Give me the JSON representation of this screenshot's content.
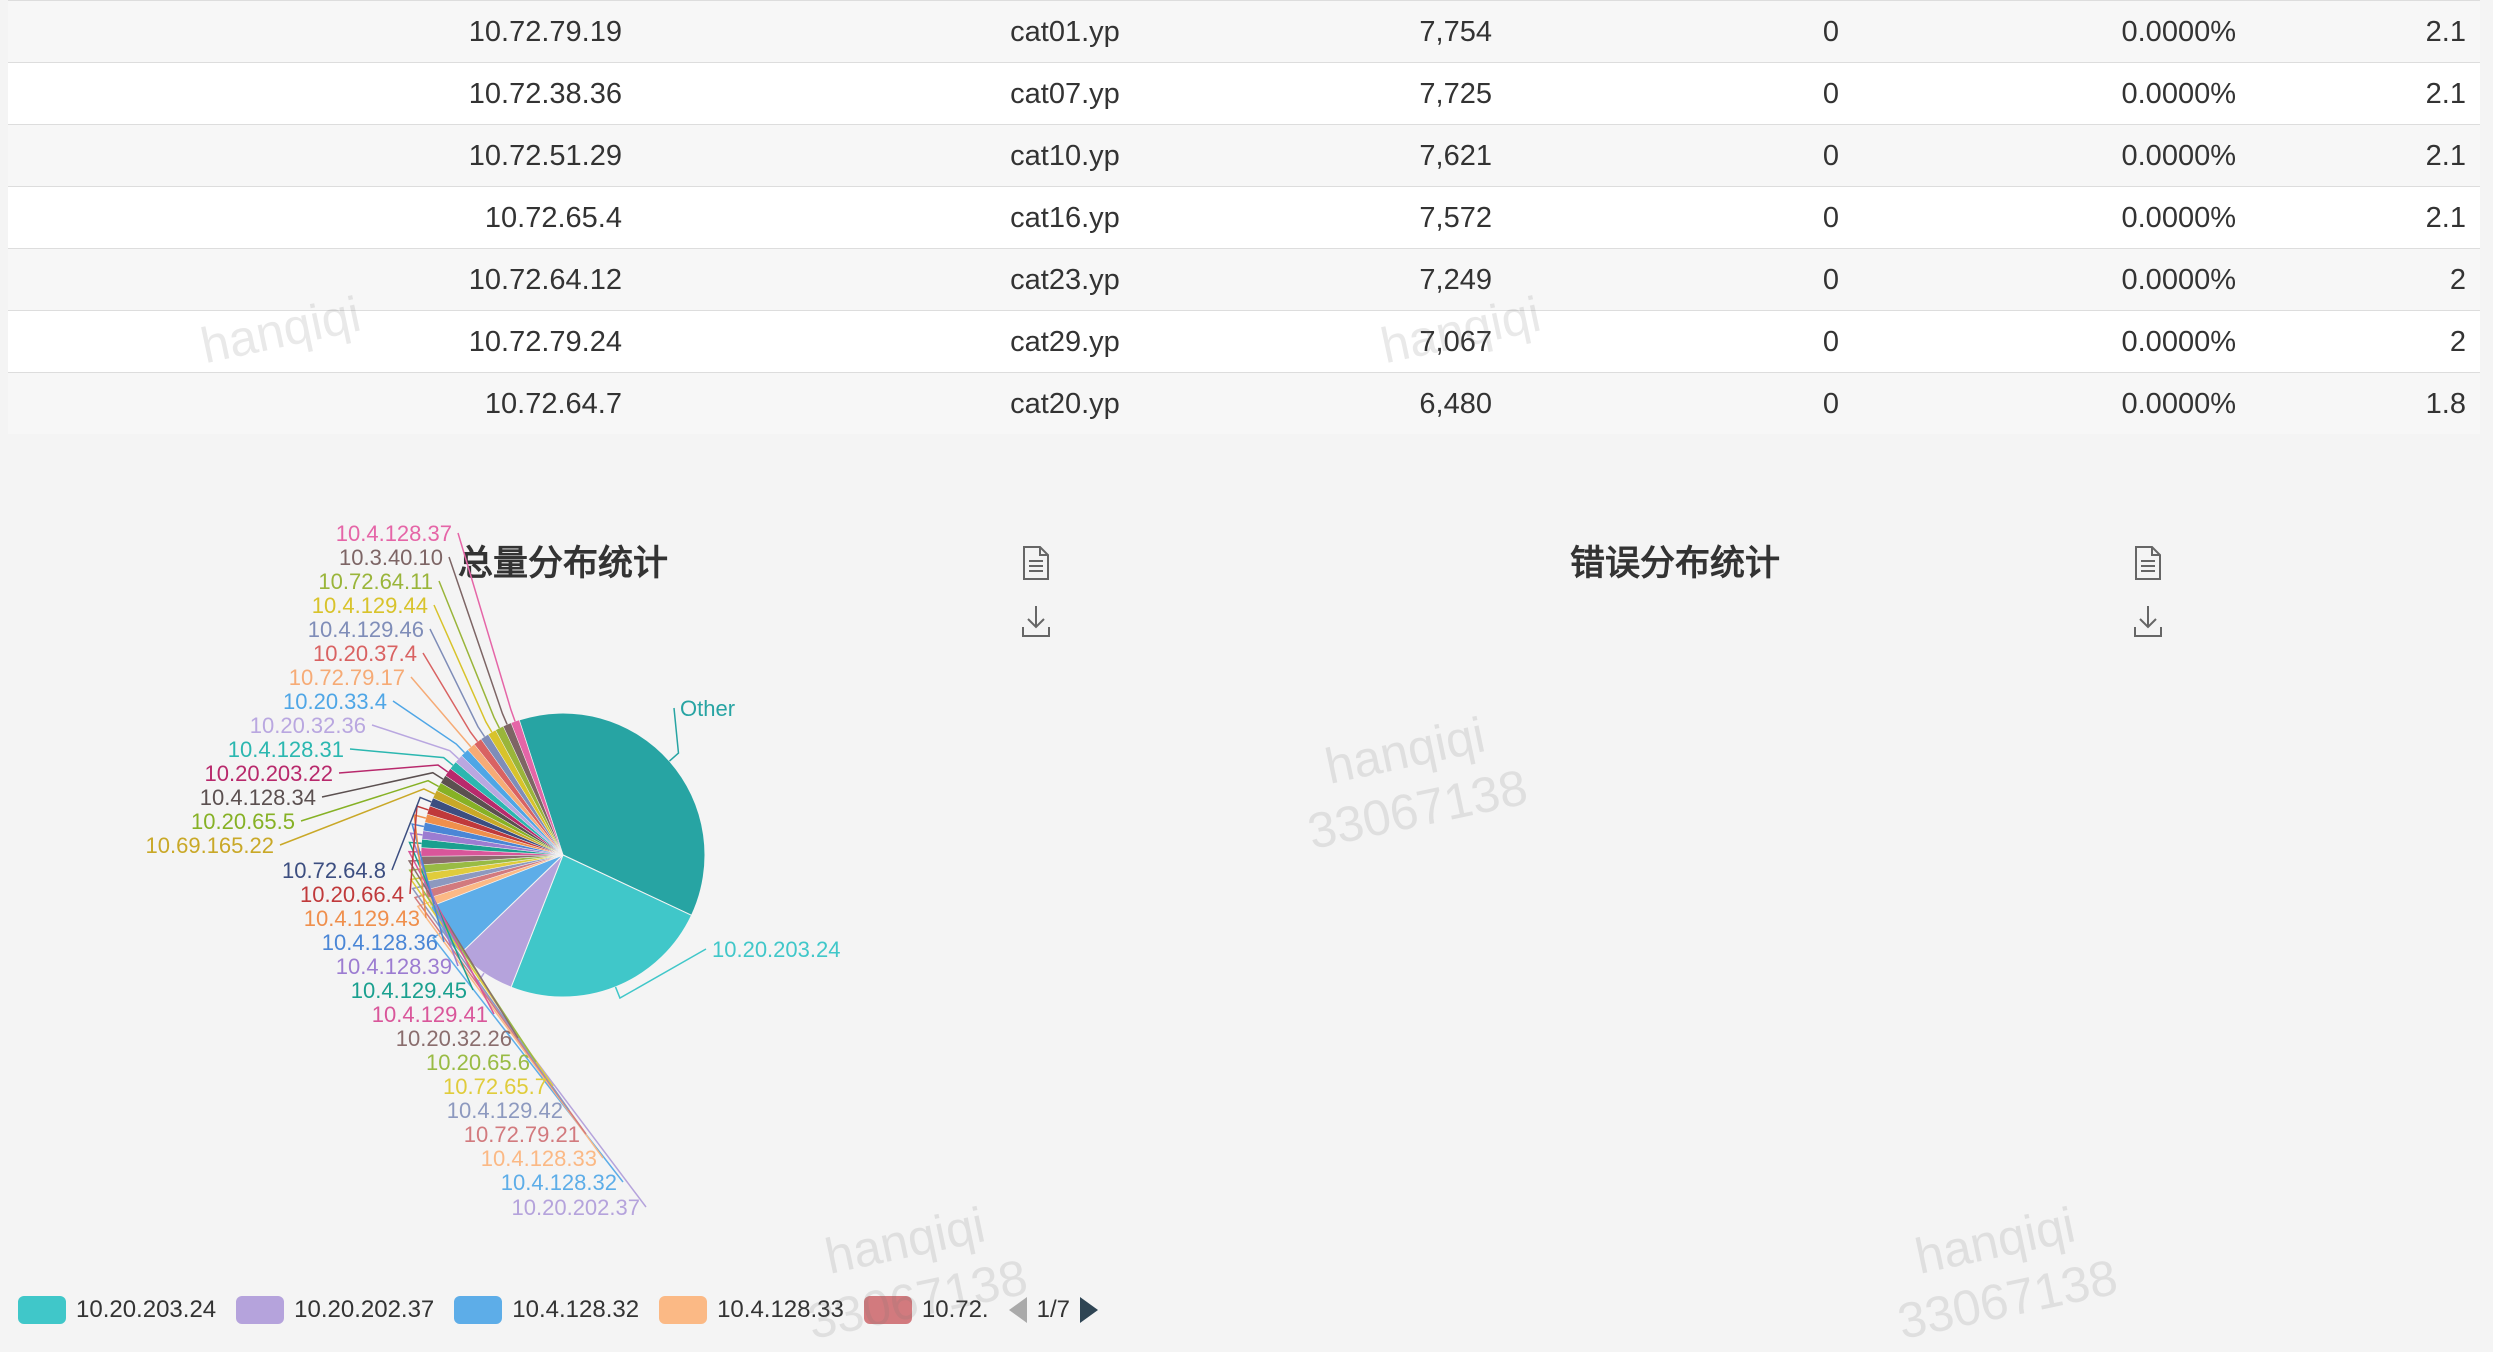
{
  "table": {
    "rows": [
      {
        "ip": "10.72.79.19",
        "host": "cat01.yp",
        "total": "7,754",
        "failures": "0",
        "failure_pct": "0.0000%",
        "qps": "2.1"
      },
      {
        "ip": "10.72.38.36",
        "host": "cat07.yp",
        "total": "7,725",
        "failures": "0",
        "failure_pct": "0.0000%",
        "qps": "2.1"
      },
      {
        "ip": "10.72.51.29",
        "host": "cat10.yp",
        "total": "7,621",
        "failures": "0",
        "failure_pct": "0.0000%",
        "qps": "2.1"
      },
      {
        "ip": "10.72.65.4",
        "host": "cat16.yp",
        "total": "7,572",
        "failures": "0",
        "failure_pct": "0.0000%",
        "qps": "2.1"
      },
      {
        "ip": "10.72.64.12",
        "host": "cat23.yp",
        "total": "7,249",
        "failures": "0",
        "failure_pct": "0.0000%",
        "qps": "2"
      },
      {
        "ip": "10.72.79.24",
        "host": "cat29.yp",
        "total": "7,067",
        "failures": "0",
        "failure_pct": "0.0000%",
        "qps": "2"
      },
      {
        "ip": "10.72.64.7",
        "host": "cat20.yp",
        "total": "6,480",
        "failures": "0",
        "failure_pct": "0.0000%",
        "qps": "1.8"
      }
    ]
  },
  "total_panel": {
    "title": "总量分布统计",
    "data_view_icon": "document-icon",
    "download_icon": "download-icon"
  },
  "error_panel": {
    "title": "错误分布统计",
    "data_view_icon": "document-icon",
    "download_icon": "download-icon"
  },
  "watermark": {
    "line1": "hanqiqi",
    "line2": "33067138"
  },
  "chart_data": {
    "type": "pie",
    "title": "总量分布统计",
    "slices": [
      {
        "label": "Other",
        "value": 27.0,
        "color": "#27a4a3"
      },
      {
        "label": "10.20.203.24",
        "value": 17.5,
        "color": "#40c7c9"
      },
      {
        "label": "10.20.202.37",
        "value": 5.0,
        "color": "#b5a3dc"
      },
      {
        "label": "10.4.128.32",
        "value": 4.6,
        "color": "#5dade8"
      },
      {
        "label": "10.4.128.33",
        "value": 0.7,
        "color": "#fbb985"
      },
      {
        "label": "10.72.79.21",
        "value": 0.7,
        "color": "#d27a7e"
      },
      {
        "label": "10.4.129.42",
        "value": 0.7,
        "color": "#8d99bf"
      },
      {
        "label": "10.72.65.7",
        "value": 0.7,
        "color": "#e0cc3b"
      },
      {
        "label": "10.20.65.6",
        "value": 0.7,
        "color": "#99bb44"
      },
      {
        "label": "10.20.32.26",
        "value": 0.7,
        "color": "#8a6d6d"
      },
      {
        "label": "10.4.129.41",
        "value": 0.7,
        "color": "#d9569a"
      },
      {
        "label": "10.4.129.45",
        "value": 0.7,
        "color": "#1aa08f"
      },
      {
        "label": "10.4.128.39",
        "value": 0.7,
        "color": "#9c7cd1"
      },
      {
        "label": "10.4.128.36",
        "value": 0.7,
        "color": "#4a86d6"
      },
      {
        "label": "10.4.129.43",
        "value": 0.7,
        "color": "#ef8f4c"
      },
      {
        "label": "10.20.66.4",
        "value": 0.7,
        "color": "#c0393b"
      },
      {
        "label": "10.72.64.8",
        "value": 0.7,
        "color": "#3c4e80"
      },
      {
        "label": "10.69.165.22",
        "value": 0.7,
        "color": "#c9a827"
      },
      {
        "label": "10.20.65.5",
        "value": 0.7,
        "color": "#86b125"
      },
      {
        "label": "10.4.128.34",
        "value": 0.7,
        "color": "#5b5050"
      },
      {
        "label": "10.20.203.22",
        "value": 0.7,
        "color": "#b8296c"
      },
      {
        "label": "10.4.128.31",
        "value": 0.7,
        "color": "#2bb7b0"
      },
      {
        "label": "10.20.32.36",
        "value": 0.7,
        "color": "#b9a7e0"
      },
      {
        "label": "10.20.33.4",
        "value": 0.7,
        "color": "#4fa6e6"
      },
      {
        "label": "10.72.79.17",
        "value": 0.7,
        "color": "#f6ab76"
      },
      {
        "label": "10.20.37.4",
        "value": 0.7,
        "color": "#d96262"
      },
      {
        "label": "10.4.129.46",
        "value": 0.7,
        "color": "#7f8db8"
      },
      {
        "label": "10.4.129.44",
        "value": 0.7,
        "color": "#d8c32b"
      },
      {
        "label": "10.72.64.11",
        "value": 0.7,
        "color": "#9ab53a"
      },
      {
        "label": "10.3.40.10",
        "value": 0.7,
        "color": "#7d6565"
      },
      {
        "label": "10.4.128.37",
        "value": 0.7,
        "color": "#e565a7"
      }
    ],
    "legend": {
      "position": "bottom-left",
      "items": [
        {
          "label": "10.20.203.24",
          "color": "#40c7c9"
        },
        {
          "label": "10.20.202.37",
          "color": "#b5a3dc"
        },
        {
          "label": "10.4.128.32",
          "color": "#5dade8"
        },
        {
          "label": "10.4.128.33",
          "color": "#fbb985"
        },
        {
          "label": "10.72.",
          "color": "#d27a7e"
        }
      ],
      "page": "1/7"
    }
  }
}
